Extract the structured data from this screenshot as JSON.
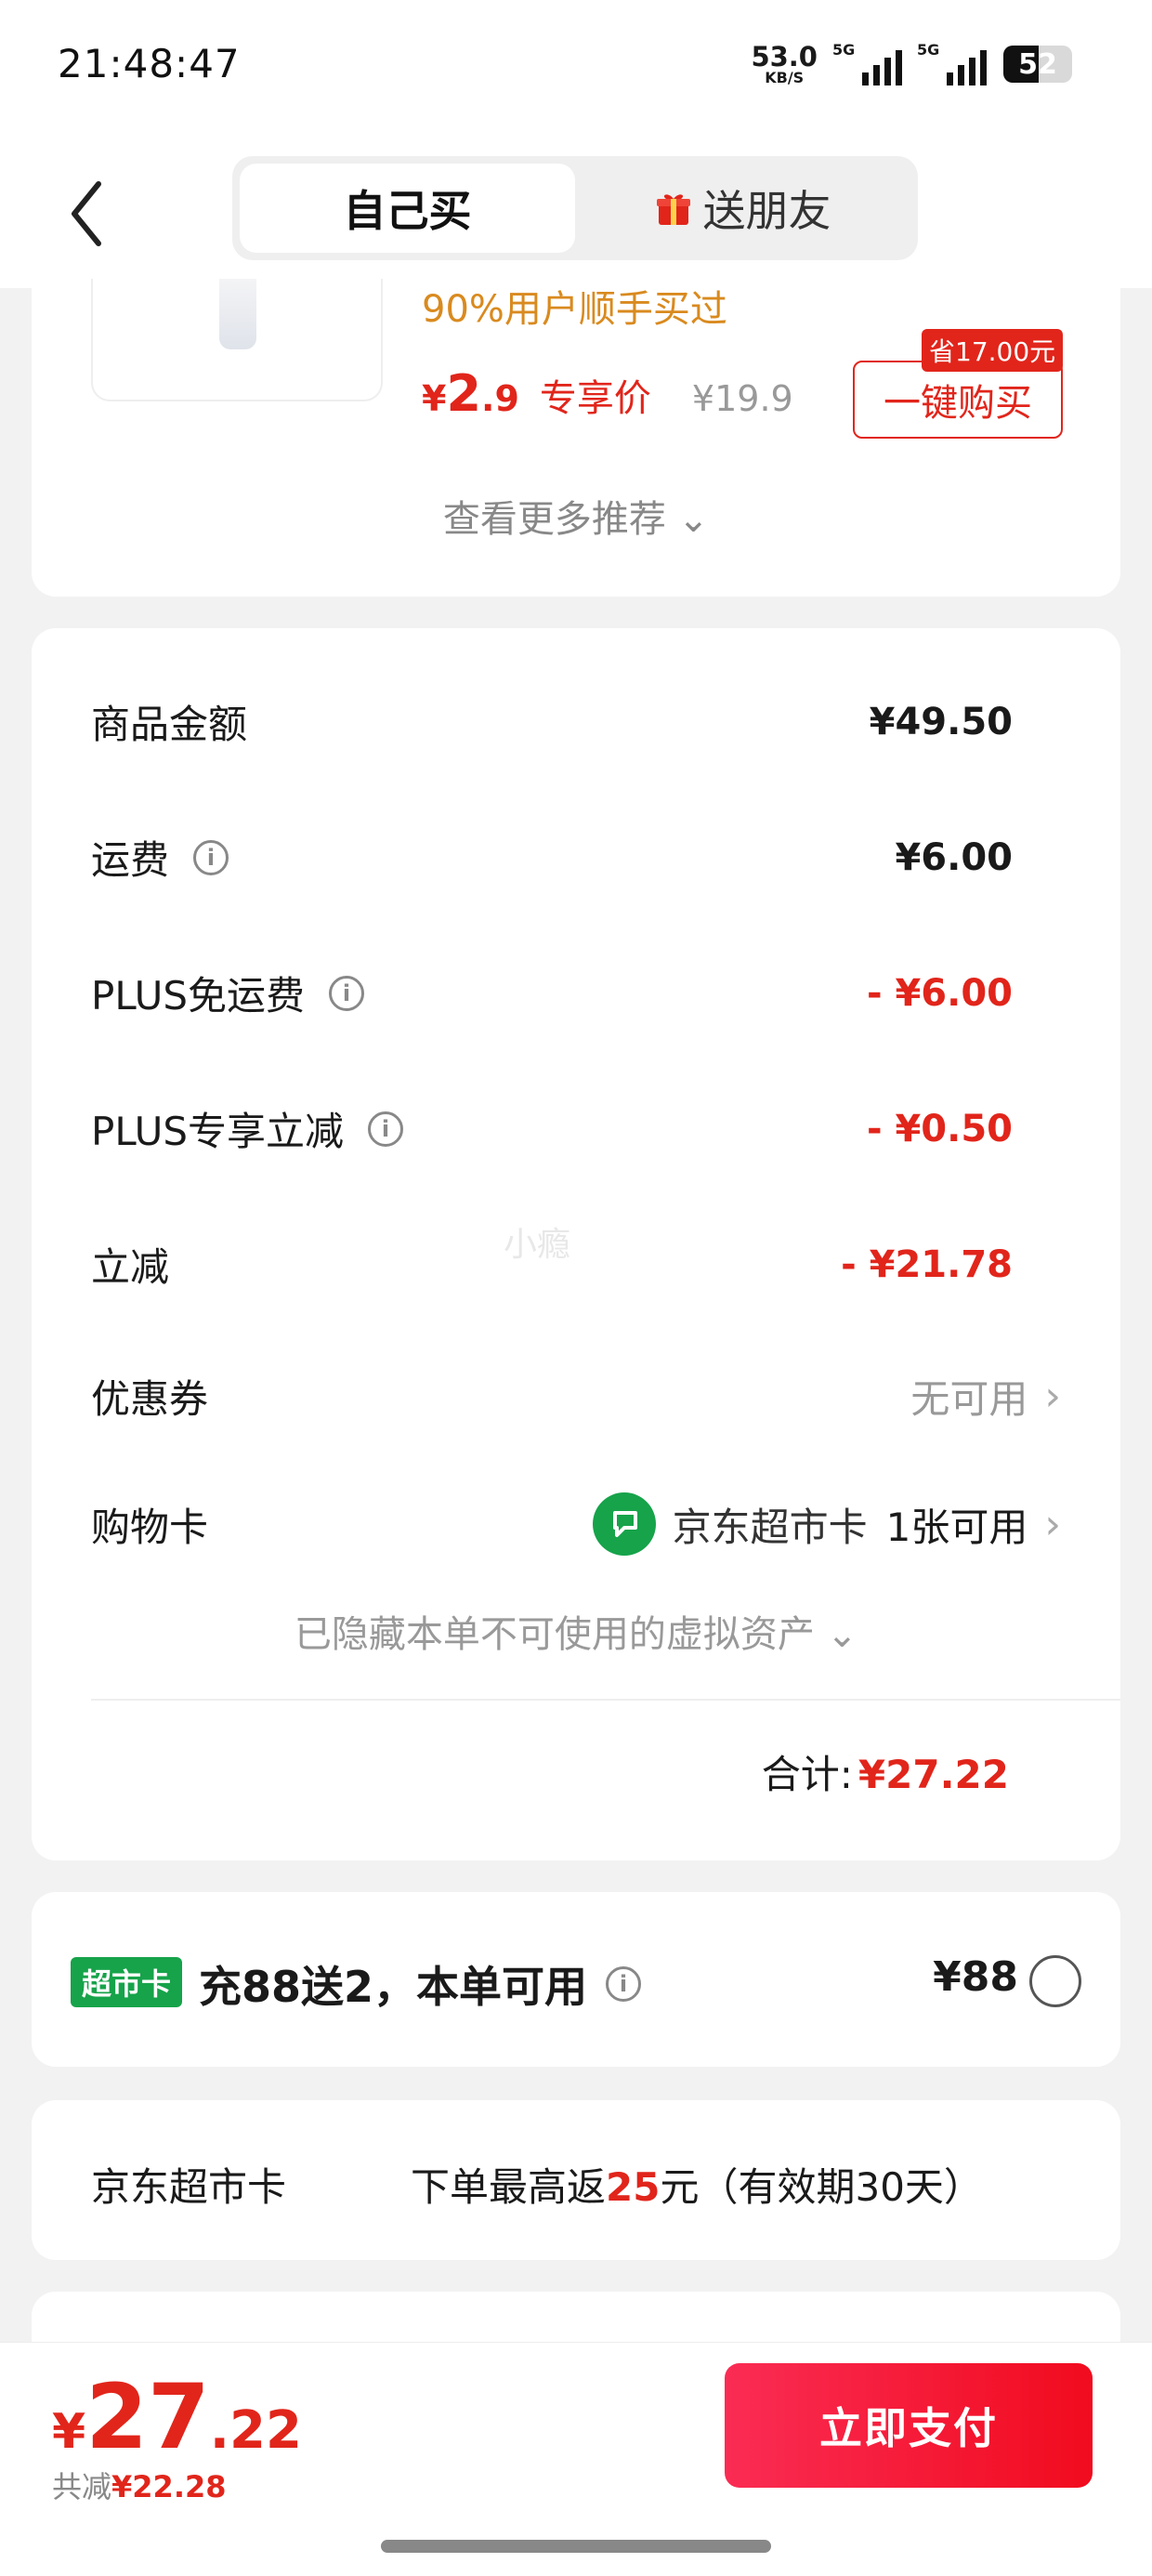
{
  "status_bar": {
    "time": "21:48:47",
    "net_speed": "53.0",
    "net_unit": "KB/S",
    "sim1": "5G",
    "sim2": "5G",
    "battery": "52"
  },
  "header": {
    "tabs": [
      {
        "label": "自己买",
        "active": true
      },
      {
        "label": "送朋友",
        "active": false,
        "icon": "gift-icon"
      }
    ]
  },
  "recommend": {
    "hint": "90%用户顺手买过",
    "currency": "¥",
    "price_int": "2",
    "price_dec": ".9",
    "exclusive_label": "专享价",
    "original_price": "¥19.9",
    "save_tag": "省17.00元",
    "buy_label": "一键购买",
    "more_label": "查看更多推荐"
  },
  "summary": {
    "goods_amount": {
      "label": "商品金额",
      "value": "¥49.50"
    },
    "shipping": {
      "label": "运费",
      "value": "¥6.00"
    },
    "plus_free_ship": {
      "label": "PLUS免运费",
      "value": "- ¥6.00"
    },
    "plus_discount": {
      "label": "PLUS专享立减",
      "value": "- ¥0.50"
    },
    "instant_discount": {
      "label": "立减",
      "value": "- ¥21.78"
    },
    "coupon": {
      "label": "优惠券",
      "value": "无可用"
    },
    "gift_card": {
      "label": "购物卡",
      "card_name": "京东超市卡",
      "value": "1张可用"
    },
    "hidden_note": "已隐藏本单不可使用的虚拟资产",
    "total_label": "合计:",
    "total_value": "¥27.22",
    "watermark": "小瘾"
  },
  "topup": {
    "badge": "超市卡",
    "offer": "充88送2，本单可用",
    "price": "¥88"
  },
  "cashback": {
    "label": "京东超市卡",
    "prefix": "下单最高返",
    "amount": "25",
    "suffix": "元（有效期30天）"
  },
  "footer": {
    "currency": "¥",
    "amount_int": "27",
    "amount_dec": ".22",
    "saved_label": "共减",
    "saved_value": "¥22.28",
    "pay_label": "立即支付"
  },
  "colors": {
    "accent_red": "#e1251b",
    "hint_orange": "#d98a1f",
    "brand_green": "#16a34a"
  }
}
